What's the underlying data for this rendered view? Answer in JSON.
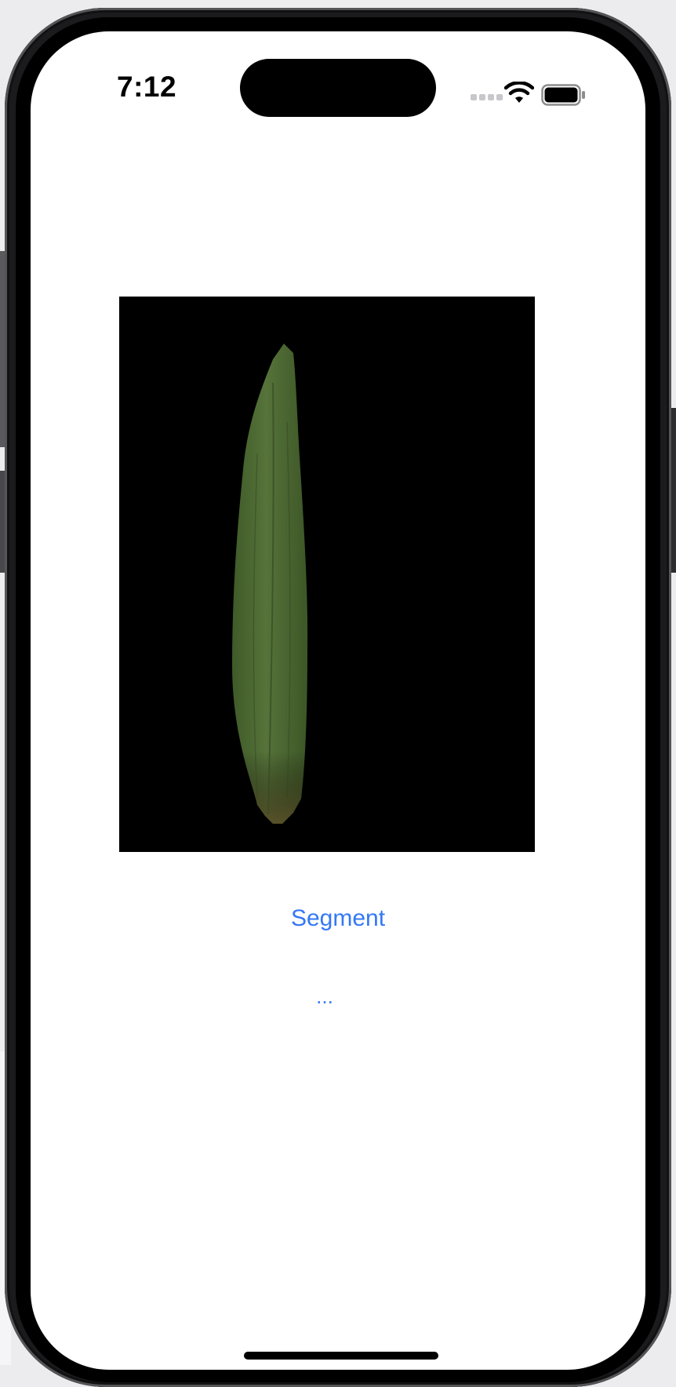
{
  "status_bar": {
    "time": "7:12",
    "cellular_icon": "cellular-signal-icon",
    "wifi_icon": "wifi-icon",
    "battery_icon": "battery-icon"
  },
  "main": {
    "image": {
      "icon": "segmented-leaf-image",
      "background_color": "#000000",
      "leaf_color": "#4f6b33"
    },
    "segment_button_label": "Segment",
    "result_text": "..."
  },
  "colors": {
    "accent": "#3478f6",
    "screen_background": "#ffffff"
  }
}
